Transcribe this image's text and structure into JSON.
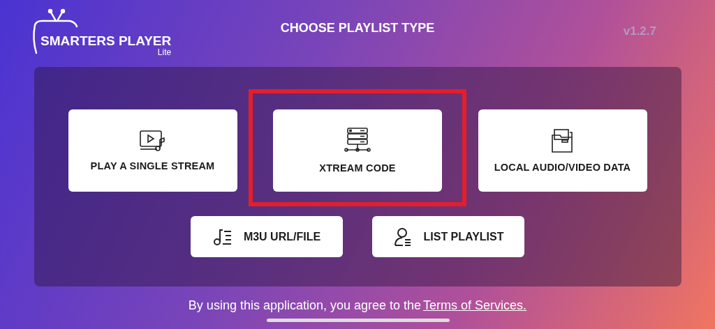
{
  "logo": {
    "name": "SMARTERS PLAYER",
    "edition": "Lite"
  },
  "title": "CHOOSE PLAYLIST TYPE",
  "version": "v1.2.7",
  "options": [
    {
      "kind": "stream",
      "label": "PLAY A SINGLE STREAM",
      "highlighted": false
    },
    {
      "kind": "xtream",
      "label": "XTREAM CODE",
      "highlighted": true
    },
    {
      "kind": "local",
      "label": "LOCAL AUDIO/VIDEO DATA",
      "highlighted": false
    }
  ],
  "secondary": [
    {
      "kind": "m3u",
      "label": "M3U URL/FILE"
    },
    {
      "kind": "list",
      "label": "LIST PLAYLIST"
    }
  ],
  "footer": {
    "text": "By using this application, you agree to the",
    "link": "Terms of Services."
  }
}
